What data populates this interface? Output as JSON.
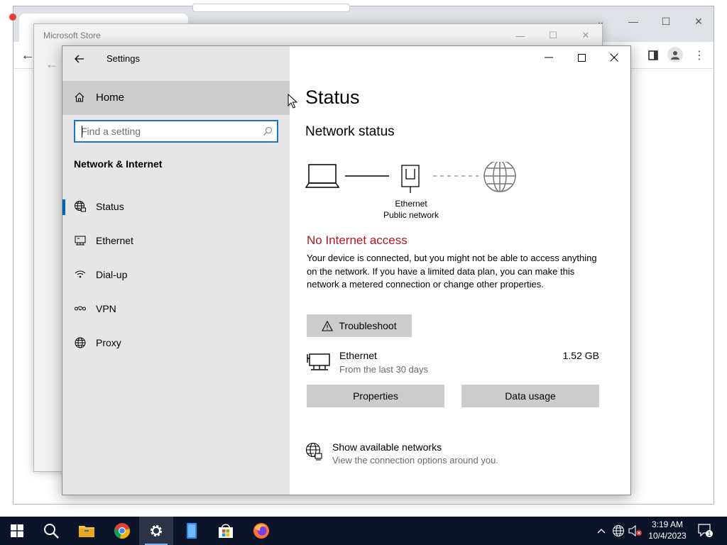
{
  "store_window": {
    "title": "Microsoft Store"
  },
  "settings": {
    "title": "Settings",
    "home_label": "Home",
    "search_placeholder": "Find a setting",
    "section_title": "Network & Internet",
    "nav_items": [
      {
        "label": "Status",
        "icon": "globe-network-icon",
        "selected": true
      },
      {
        "label": "Ethernet",
        "icon": "ethernet-icon",
        "selected": false
      },
      {
        "label": "Dial-up",
        "icon": "dialup-icon",
        "selected": false
      },
      {
        "label": "VPN",
        "icon": "vpn-icon",
        "selected": false
      },
      {
        "label": "Proxy",
        "icon": "globe-icon",
        "selected": false
      }
    ],
    "content": {
      "page_title": "Status",
      "network_status_title": "Network status",
      "adapter_name": "Ethernet",
      "network_type": "Public network",
      "alert_title": "No Internet access",
      "alert_description": "Your device is connected, but you might not be able to access anything on the network. If you have a limited data plan, you can make this network a metered connection or change other properties.",
      "troubleshoot_label": "Troubleshoot",
      "ethernet": {
        "name": "Ethernet",
        "period": "From the last 30 days",
        "usage": "1.52 GB"
      },
      "properties_label": "Properties",
      "data_usage_label": "Data usage",
      "show_networks_title": "Show available networks",
      "show_networks_desc": "View the connection options around you."
    }
  },
  "taskbar": {
    "time": "3:19 AM",
    "date": "10/4/2023",
    "notification_count": "1"
  },
  "colors": {
    "accent": "#0067c0",
    "alert": "#b3161c",
    "sidebar_bg": "#e6e6e6",
    "button_bg": "#cccccc",
    "taskbar_bg": "#0b1428"
  }
}
